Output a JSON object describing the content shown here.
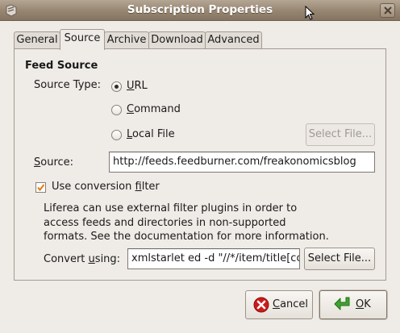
{
  "window": {
    "title": "Subscription Properties"
  },
  "tabs": [
    {
      "label": "General"
    },
    {
      "label": "Source"
    },
    {
      "label": "Archive"
    },
    {
      "label": "Download"
    },
    {
      "label": "Advanced"
    }
  ],
  "feed_source": {
    "section_title": "Feed Source",
    "source_type_label": "Source Type:",
    "options": {
      "url": {
        "before": "",
        "mnemonic": "U",
        "after": "RL",
        "checked": true
      },
      "command": {
        "before": "",
        "mnemonic": "C",
        "after": "ommand",
        "checked": false
      },
      "local_file": {
        "before": "",
        "mnemonic": "L",
        "after": "ocal File",
        "checked": false
      }
    },
    "select_file_disabled_label": "Select File...",
    "source_label": {
      "before": "",
      "mnemonic": "S",
      "after": "ource:"
    },
    "source_value": "http://feeds.feedburner.com/freakonomicsblog"
  },
  "filter": {
    "use_filter_label": {
      "before": "Use conversion ",
      "mnemonic": "f",
      "after": "ilter"
    },
    "checked": true,
    "description_lines": [
      "Liferea can use external filter plugins in order to",
      "access feeds and directories in non-supported",
      "formats.  See the documentation for more information."
    ],
    "convert_label": {
      "before": "Convert ",
      "mnemonic": "u",
      "after": "sing:"
    },
    "convert_value": "xmlstarlet ed -d \"//*/item/title[co",
    "select_file_label": "Select File..."
  },
  "actions": {
    "cancel": {
      "before": "",
      "mnemonic": "C",
      "after": "ancel"
    },
    "ok": {
      "before": "",
      "mnemonic": "O",
      "after": "K"
    }
  },
  "colors": {
    "titlebar": "#968571",
    "window_bg": "#efebe7",
    "ok_icon": "#3ea32f",
    "cancel_icon": "#cc1a1a"
  }
}
